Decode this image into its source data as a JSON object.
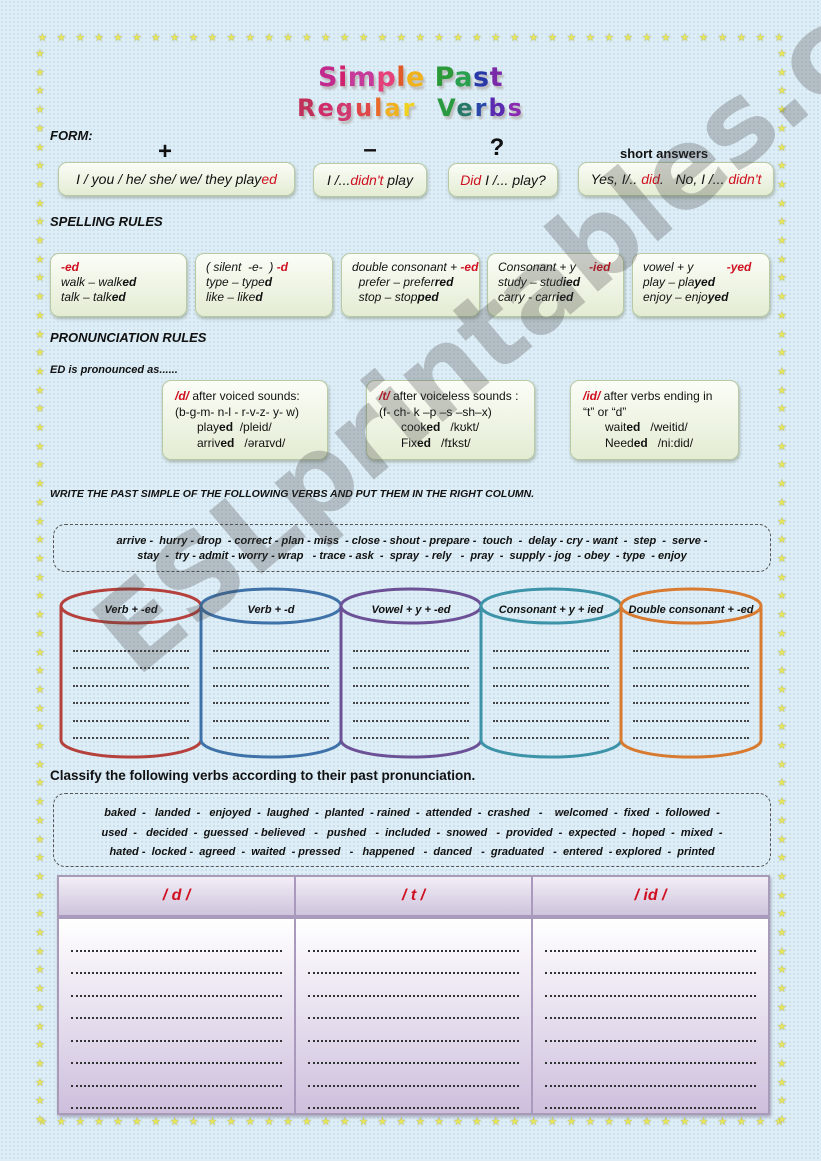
{
  "title": {
    "line1": [
      {
        "t": "S",
        "c": "#c22a8e"
      },
      {
        "t": "i",
        "c": "#d0226f"
      },
      {
        "t": "m",
        "c": "#c63a9a"
      },
      {
        "t": "p",
        "c": "#e5407a"
      },
      {
        "t": "l",
        "c": "#e05a2a"
      },
      {
        "t": "e",
        "c": "#f0b21a"
      },
      {
        "t": " ",
        "c": "#000"
      },
      {
        "t": "P",
        "c": "#2d9a3a"
      },
      {
        "t": "a",
        "c": "#28a050"
      },
      {
        "t": "s",
        "c": "#2838a8"
      },
      {
        "t": "t",
        "c": "#7a2aa8"
      }
    ],
    "line2": [
      {
        "t": "R",
        "c": "#c0305a"
      },
      {
        "t": "e",
        "c": "#d02c6a"
      },
      {
        "t": "g",
        "c": "#d03a6e"
      },
      {
        "t": "u",
        "c": "#e04848"
      },
      {
        "t": "l",
        "c": "#e86a2a"
      },
      {
        "t": "a",
        "c": "#f0b020"
      },
      {
        "t": "r",
        "c": "#f0d020"
      },
      {
        "t": "  ",
        "c": "#000"
      },
      {
        "t": "V",
        "c": "#2a9a40"
      },
      {
        "t": "e",
        "c": "#28786a"
      },
      {
        "t": "r",
        "c": "#2a48a8"
      },
      {
        "t": "b",
        "c": "#5a2ab0"
      },
      {
        "t": "s",
        "c": "#8a2ab0"
      }
    ]
  },
  "form": {
    "heading": "FORM:",
    "positive": {
      "symbol": "+",
      "text_pre": "I / you / he/ she/ we/ they play",
      "text_red": "ed"
    },
    "negative": {
      "symbol": "–",
      "text_pre": "I /...",
      "text_red": "didn't",
      "text_post": " play"
    },
    "question": {
      "symbol": "?",
      "text_red": "Did",
      "text_post": " I /... play?"
    },
    "short": {
      "heading": "short answers",
      "yes_pre": "Yes, I/.. ",
      "yes_red": "did",
      "yes_post": ".   No, I /... ",
      "no_red": "didn't"
    }
  },
  "spelling": {
    "heading": "SPELLING RULES",
    "rules": [
      {
        "title_pre": "",
        "title_red": "-ed",
        "lines": [
          [
            "walk – walk",
            "ed"
          ],
          [
            "talk – talk",
            "ed"
          ]
        ]
      },
      {
        "title_pre": "( silent  -e-  ) ",
        "title_red": "-d",
        "lines": [
          [
            "type – type",
            "d"
          ],
          [
            "like – like",
            "d"
          ]
        ]
      },
      {
        "title_pre": "double consonant + ",
        "title_red": "-ed",
        "lines": [
          [
            "  prefer – prefer",
            "red"
          ],
          [
            "  stop – stop",
            "ped"
          ]
        ]
      },
      {
        "title_pre": "Consonant + y    ",
        "title_red": "-ied",
        "lines": [
          [
            "study – stud",
            "ied"
          ],
          [
            "carry - carr",
            "ied"
          ]
        ]
      },
      {
        "title_pre": "vowel + y          ",
        "title_red": "-yed",
        "lines": [
          [
            "play – pla",
            "yed"
          ],
          [
            "enjoy – enjo",
            "yed"
          ]
        ]
      }
    ]
  },
  "pronunciation": {
    "heading": "PRONUNCIATION RULES",
    "intro": "ED is pronounced as......",
    "rules": [
      {
        "sound": "/d/",
        "desc": " after voiced sounds:",
        "line2": "(b-g-m- n-l - r-v-z- y- w)",
        "ex": [
          [
            "play",
            "ed",
            "  /pleid/"
          ],
          [
            "arriv",
            "ed",
            "   /əraɪvd/"
          ]
        ]
      },
      {
        "sound": "/t/",
        "desc": " after voiceless sounds :",
        "line2": "(f- ch- k –p –s –sh–x)",
        "ex": [
          [
            "cook",
            "ed",
            "   /kʊkt/"
          ],
          [
            "Fix",
            "ed",
            "   /fɪkst/"
          ]
        ]
      },
      {
        "sound": "/id/",
        "desc": " after verbs ending in",
        "line2": "“t” or “d”",
        "ex": [
          [
            "wait",
            "ed",
            "   /weitid/"
          ],
          [
            "Need",
            "ed",
            "   /ni:did/"
          ]
        ]
      }
    ]
  },
  "exercise1": {
    "instruction": "WRITE THE PAST SIMPLE OF THE FOLLOWING VERBS AND PUT THEM  IN THE RIGHT COLUMN.",
    "verbs_line1": "arrive -  hurry - drop  - correct - plan - miss  - close - shout - prepare -  touch  -  delay - cry - want  -  step  -  serve -",
    "verbs_line2": "stay  -  try - admit - worry - wrap   - trace - ask  -  spray  - rely   -  pray  -  supply - jog  - obey  - type  - enjoy",
    "columns": [
      {
        "label": "Verb + -ed",
        "color": "#b5403c"
      },
      {
        "label": "Verb + -d",
        "color": "#3f72a8"
      },
      {
        "label": "Vowel + y + -ed",
        "color": "#6c5197"
      },
      {
        "label": "Consonant + y + ied",
        "color": "#3d93a8"
      },
      {
        "label": "Double consonant + -ed",
        "color": "#d87a30"
      }
    ]
  },
  "exercise2": {
    "instruction": "Classify the following verbs according to their past pronunciation.",
    "verbs_line1": "baked  -   landed  -   enjoyed  -  laughed  -  planted  - rained  -  attended  -  crashed   -    welcomed  -  fixed  -  followed  -",
    "verbs_line2": "used  -   decided  -  guessed  - believed   -   pushed   -  included  -  snowed   -  provided  -  expected  -  hoped  -  mixed  -",
    "verbs_line3": "hated -  locked -  agreed  -  waited  - pressed   -   happened   -  danced   -  graduated   -  entered  - explored  -  printed",
    "columns": [
      "/ d /",
      "/ t /",
      "/ id /"
    ]
  },
  "watermark": "ESLprintables.com"
}
